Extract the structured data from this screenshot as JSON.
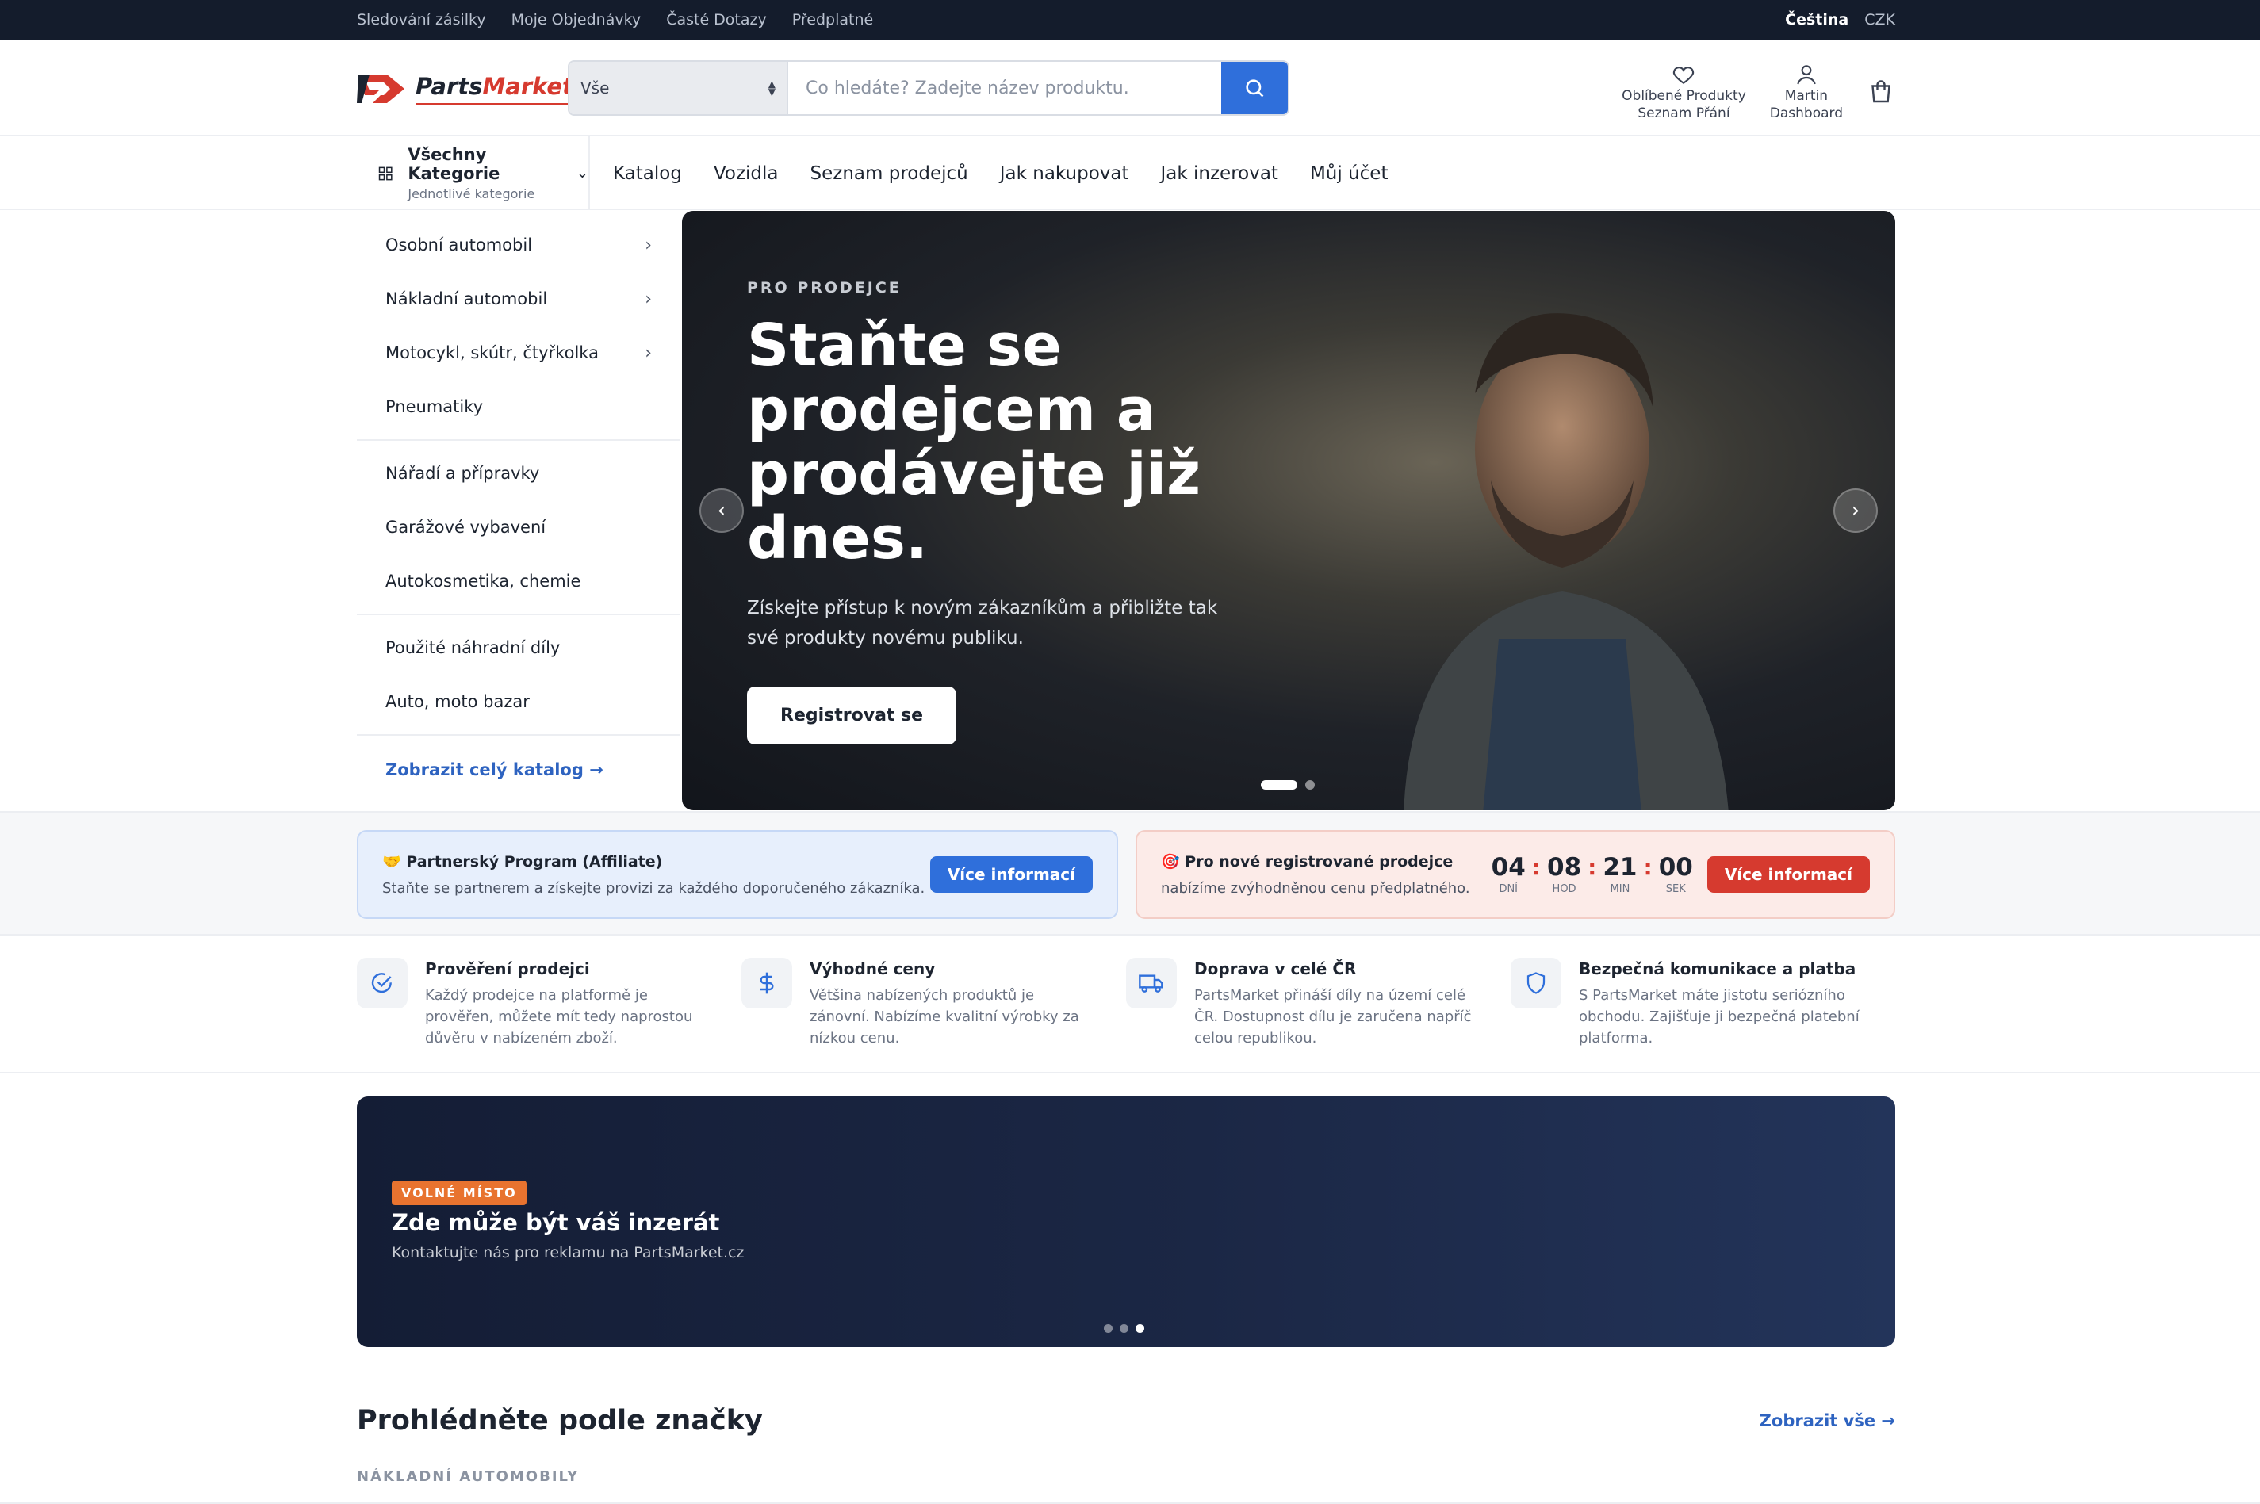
{
  "topbar": {
    "links": [
      "Sledování zásilky",
      "Moje Objednávky",
      "Časté Dotazy",
      "Předplatné"
    ],
    "language": "Čeština",
    "currency": "CZK"
  },
  "header": {
    "logo": {
      "part1": "Parts",
      "part2": "Market"
    },
    "search": {
      "category_value": "Vše",
      "placeholder": "Co hledáte? Zadejte název produktu."
    },
    "favorites": {
      "line1": "Oblíbené Produkty",
      "line2": "Seznam Přání"
    },
    "account": {
      "line1": "Martin",
      "line2": "Dashboard"
    }
  },
  "nav": {
    "all_categories": {
      "title": "Všechny Kategorie",
      "subtitle": "Jednotlivé kategorie"
    },
    "links": [
      "Katalog",
      "Vozidla",
      "Seznam prodejců",
      "Jak nakupovat",
      "Jak inzerovat",
      "Můj účet"
    ]
  },
  "sidebar": {
    "group1": [
      {
        "label": "Osobní automobil",
        "has_children": true
      },
      {
        "label": "Nákladní automobil",
        "has_children": true
      },
      {
        "label": "Motocykl, skútr, čtyřkolka",
        "has_children": true
      },
      {
        "label": "Pneumatiky",
        "has_children": false
      }
    ],
    "group2": [
      {
        "label": "Nářadí a přípravky"
      },
      {
        "label": "Garážové vybavení"
      },
      {
        "label": "Autokosmetika, chemie"
      }
    ],
    "group3": [
      {
        "label": "Použité náhradní díly"
      },
      {
        "label": "Auto, moto bazar"
      }
    ],
    "catalog_link": "Zobrazit celý katalog →"
  },
  "hero": {
    "eyebrow": "PRO PRODEJCE",
    "title": "Staňte se prodejcem a prodávejte již dnes.",
    "subtitle": "Získejte přístup k novým zákazníkům a přibližte tak své produkty novému publiku.",
    "cta": "Registrovat se",
    "prev": "‹",
    "next": "›",
    "slides": 2,
    "active_slide": 1
  },
  "promo": {
    "affiliate": {
      "icon": "🤝",
      "title": "Partnerský Program (Affiliate)",
      "text": "Staňte se partnerem a získejte provizi za každého doporučeného zákazníka.",
      "button": "Více informací"
    },
    "sellers": {
      "icon": "🎯",
      "title": "Pro nové registrované prodejce",
      "text": "nabízíme zvýhodněnou cenu předplatného.",
      "button": "Více informací",
      "countdown": [
        {
          "value": "04",
          "label": "DNÍ"
        },
        {
          "value": "08",
          "label": "HOD"
        },
        {
          "value": "21",
          "label": "MIN"
        },
        {
          "value": "00",
          "label": "SEK"
        }
      ]
    }
  },
  "features": [
    {
      "icon": "check-circle-icon",
      "title": "Prověření prodejci",
      "text": "Každý prodejce na platformě je prověřen, můžete mít tedy naprostou důvěru v nabízeném zboží."
    },
    {
      "icon": "dollar-icon",
      "title": "Výhodné ceny",
      "text": "Většina nabízených produktů je zánovní. Nabízíme kvalitní výrobky za nízkou cenu."
    },
    {
      "icon": "truck-icon",
      "title": "Doprava v celé ČR",
      "text": "PartsMarket přináší díly na území celé ČR. Dostupnost dílu je zaručena napříč celou republikou."
    },
    {
      "icon": "shield-icon",
      "title": "Bezpečná komunikace a platba",
      "text": "S PartsMarket máte jistotu seriózního obchodu. Zajišťuje ji bezpečná platební platforma."
    }
  ],
  "ad": {
    "badge": "VOLNÉ MÍSTO",
    "title": "Zde může být váš inzerát",
    "subtitle": "Kontaktujte nás pro reklamu na PartsMarket.cz",
    "slides": 3,
    "active_slide": 3
  },
  "brands": {
    "title": "Prohlédněte podle značky",
    "view_all": "Zobrazit vše →",
    "section": "NÁKLADNÍ AUTOMOBILY"
  },
  "colors": {
    "topbar": "#141c2c",
    "primary_blue": "#2f6fdb",
    "accent_red": "#d63a2f",
    "badge_orange": "#e8732f"
  }
}
